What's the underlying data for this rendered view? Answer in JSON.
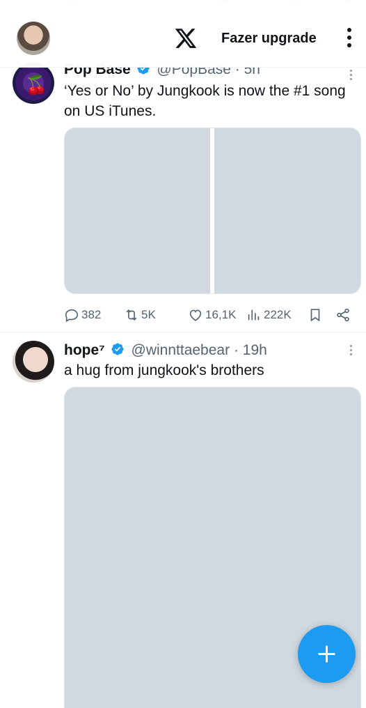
{
  "header": {
    "upgrade_label": "Fazer upgrade"
  },
  "tweets": [
    {
      "name": "Pop Base",
      "handle": "@PopBase",
      "time": "· 5h",
      "text": "‘Yes or No’ by Jungkook is now the #1 song on US iTunes.",
      "replies": "382",
      "retweets": "5K",
      "likes": "16,1K",
      "views": "222K"
    },
    {
      "name": "hope⁷",
      "handle": "@winnttaebear",
      "time": "· 19h",
      "text": "a hug from jungkook's brothers"
    }
  ],
  "icons": {
    "logo": "x-logo-icon",
    "more": "more-vertical-icon",
    "verified": "verified-badge-icon",
    "reply": "reply-icon",
    "retweet": "retweet-icon",
    "like": "heart-icon",
    "views": "views-icon",
    "bookmark": "bookmark-icon",
    "share": "share-icon",
    "compose": "plus-icon"
  },
  "colors": {
    "accent": "#1d9bf0",
    "text": "#0f1419",
    "secondary_text": "#536471",
    "media_placeholder": "#d0d9df"
  }
}
